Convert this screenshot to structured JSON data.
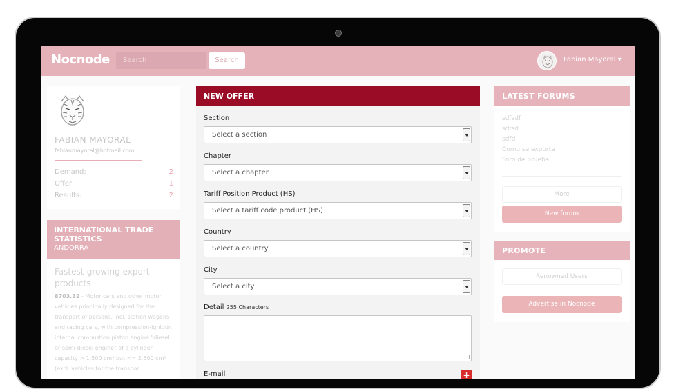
{
  "topbar": {
    "logo": "Nocnode",
    "search_placeholder": "Search",
    "search_button": "Search",
    "user_name": "Fabian Mayoral ▾"
  },
  "profile": {
    "name": "FABIAN MAYORAL",
    "email": "fabianmayoral@hotmail.com",
    "stats": [
      {
        "label": "Demand:",
        "value": "2"
      },
      {
        "label": "Offer:",
        "value": "1"
      },
      {
        "label": "Results:",
        "value": "2"
      }
    ]
  },
  "trade": {
    "title": "INTERNATIONAL TRADE STATISTICS",
    "country": "ANDORRA"
  },
  "export": {
    "title": "Fastest-growing export products",
    "code": "8703.32",
    "description": " - Motor cars and other motor vehicles principally designed for the transport of persons, incl. station wagons and racing cars, with compression-ignition internal combustion piston engine \"diesel or semi-diesel engine\" of a cylinder capacity > 1.500 cm³ but <= 2.500 cm³ (excl. vehicles for the transpor"
  },
  "form": {
    "title": "NEW OFFER",
    "section_label": "Section",
    "section_value": "Select a section",
    "chapter_label": "Chapter",
    "chapter_value": "Select a chapter",
    "tariff_label": "Tariff Position Product (HS)",
    "tariff_value": "Select a tariff code product (HS)",
    "country_label": "Country",
    "country_value": "Select a country",
    "city_label": "City",
    "city_value": "Select a city",
    "detail_label": "Detail",
    "detail_hint": "255 Characters",
    "email_label": "E-mail",
    "add_icon": "+"
  },
  "forums": {
    "title": "LATEST FORUMS",
    "items": [
      "sdfsdf",
      "sdfsd",
      "sdfd",
      "Como se exporta",
      "Foro de prueba"
    ],
    "more_button": "More",
    "new_forum_button": "New forum"
  },
  "promote": {
    "title": "PROMOTE",
    "renowned_button": "Renowned Users",
    "advertise_button": "Advertise in Nocnode"
  },
  "colors": {
    "accent": "#9a0c25",
    "topbar": "#e6b2ba",
    "pink_button": "#ebb5b7"
  }
}
